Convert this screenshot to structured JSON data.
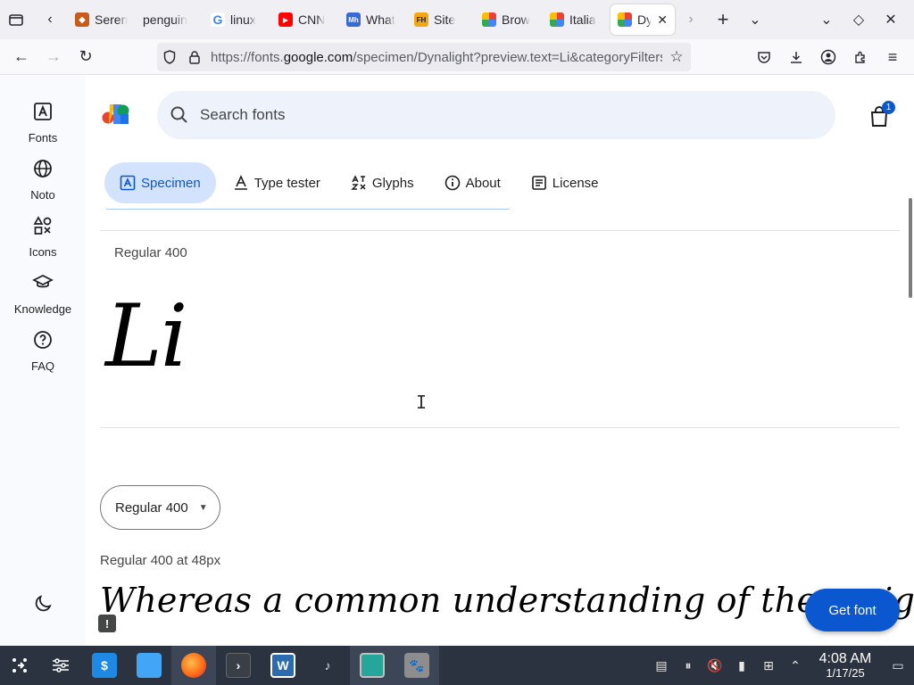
{
  "browser": {
    "tabs": [
      {
        "title": "Seren",
        "favicon": "shield-favicon",
        "color": "#c75b1c"
      },
      {
        "title": "penguin",
        "favicon": "none",
        "color": "#ffffff"
      },
      {
        "title": "linux",
        "favicon": "google-favicon",
        "color": "#4285f4"
      },
      {
        "title": "CNN",
        "favicon": "youtube-favicon",
        "color": "#ff0000"
      },
      {
        "title": "What",
        "favicon": "mh-favicon",
        "color": "#3869d4"
      },
      {
        "title": "Site",
        "favicon": "fh-favicon",
        "color": "#f3a712"
      },
      {
        "title": "Brow",
        "favicon": "google-fonts-favicon",
        "color": "#4285f4"
      },
      {
        "title": "Italia",
        "favicon": "google-fonts-favicon",
        "color": "#4285f4"
      },
      {
        "title": "Dy",
        "favicon": "google-fonts-favicon",
        "color": "#4285f4",
        "active": true
      }
    ],
    "fav_labels": {
      "mh": "Mh",
      "fh": "FH"
    },
    "url_prefix": "https://fonts.",
    "url_domain": "google.com",
    "url_path": "/specimen/Dynalight?preview.text=Li&categoryFilters"
  },
  "sidebar": {
    "items": [
      {
        "label": "Fonts",
        "icon": "fonts-icon"
      },
      {
        "label": "Noto",
        "icon": "globe-icon"
      },
      {
        "label": "Icons",
        "icon": "shapes-icon"
      },
      {
        "label": "Knowledge",
        "icon": "graduation-cap-icon"
      },
      {
        "label": "FAQ",
        "icon": "help-icon"
      }
    ]
  },
  "header": {
    "search_placeholder": "Search fonts",
    "cart_count": "1"
  },
  "page_tabs": [
    {
      "label": "Specimen",
      "icon": "specimen-icon",
      "active": true
    },
    {
      "label": "Type tester",
      "icon": "type-tester-icon"
    },
    {
      "label": "Glyphs",
      "icon": "glyphs-icon"
    },
    {
      "label": "About",
      "icon": "info-icon"
    },
    {
      "label": "License",
      "icon": "license-icon"
    }
  ],
  "specimen": {
    "style_label": "Regular 400",
    "preview_text": "Li",
    "weight_select": "Regular 400",
    "size_label": "Regular 400 at 48px",
    "sample_text": "Whereas a common understanding of these rights and fre",
    "get_font_label": "Get font"
  },
  "taskbar": {
    "time": "4:08 AM",
    "date": "1/17/25"
  },
  "colors": {
    "accent": "#0b57d0",
    "accent_light": "#d3e3fd",
    "sidebar_bg": "#f8fafd",
    "taskbar_bg": "#2b3340"
  }
}
